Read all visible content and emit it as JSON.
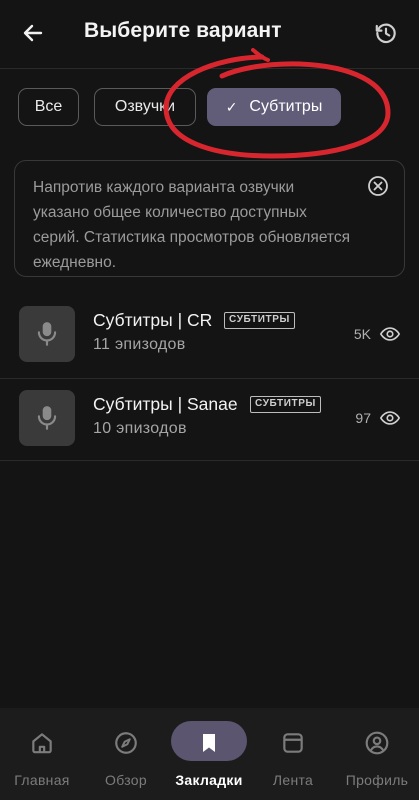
{
  "header": {
    "title": "Выберите вариант",
    "back_icon": "arrow-left-icon",
    "history_icon": "history-icon"
  },
  "filters": {
    "all": "Все",
    "dub": "Озвучки",
    "sub": "Субтитры",
    "selected": "Субтитры"
  },
  "info": {
    "text": "Напротив каждого варианта озвучки указано общее количество доступных серий. Статистика просмотров обновляется ежедневно."
  },
  "items": [
    {
      "title": "Субтитры | CR",
      "badge": "СУБТИТРЫ",
      "episodes": "11 эпизодов",
      "views": "5K"
    },
    {
      "title": "Субтитры | Sanae",
      "badge": "СУБТИТРЫ",
      "episodes": "10 эпизодов",
      "views": "97"
    }
  ],
  "nav": {
    "home": "Главная",
    "browse": "Обзор",
    "bookmarks": "Закладки",
    "feed": "Лента",
    "profile": "Профиль",
    "active": "Закладки"
  },
  "colors": {
    "background": "#141414",
    "accent": "#615c78",
    "annotation": "#d8262f"
  }
}
